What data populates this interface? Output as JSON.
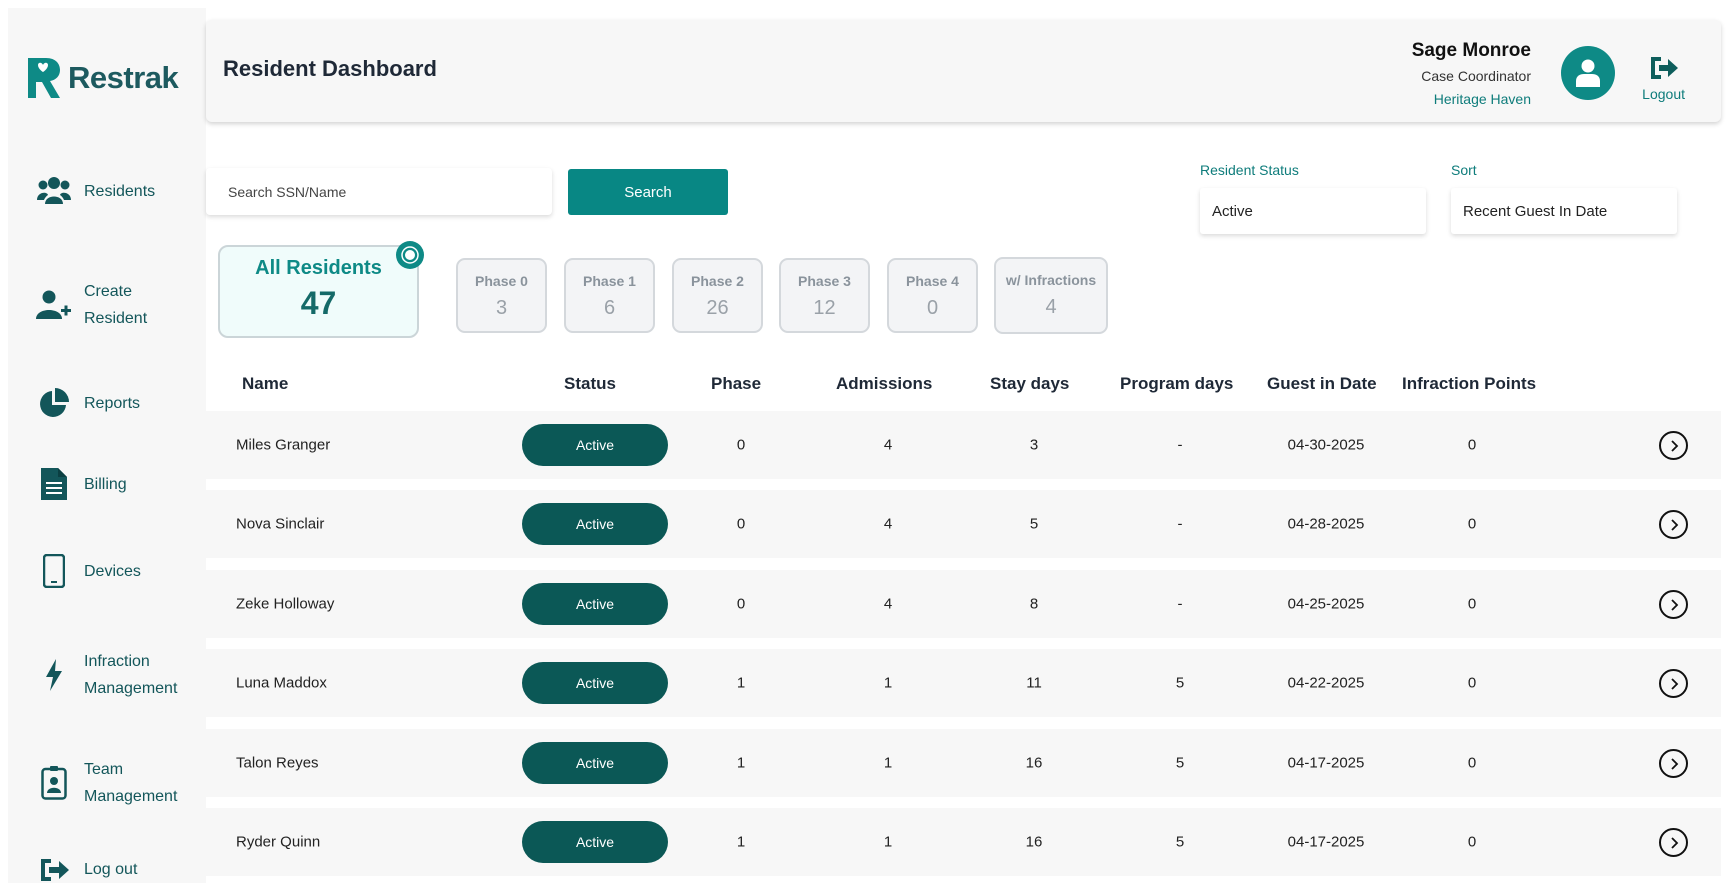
{
  "brand": {
    "name": "Restrak"
  },
  "sidebar": {
    "items": [
      {
        "line1": "Residents",
        "line2": ""
      },
      {
        "line1": "Create",
        "line2": "Resident"
      },
      {
        "line1": "Reports",
        "line2": ""
      },
      {
        "line1": "Billing",
        "line2": ""
      },
      {
        "line1": "Devices",
        "line2": ""
      },
      {
        "line1": "Infraction",
        "line2": "Management"
      },
      {
        "line1": "Team",
        "line2": "Management"
      },
      {
        "line1": "Log out",
        "line2": ""
      }
    ]
  },
  "header": {
    "title": "Resident Dashboard",
    "user_name": "Sage Monroe",
    "user_role": "Case Coordinator",
    "user_org": "Heritage Haven",
    "logout_label": "Logout"
  },
  "search": {
    "placeholder": "Search SSN/Name",
    "button_label": "Search"
  },
  "filters": {
    "status_label": "Resident Status",
    "status_value": "Active",
    "sort_label": "Sort",
    "sort_value": "Recent Guest In Date"
  },
  "summary": {
    "all_label": "All Residents",
    "all_count": "47",
    "cards": [
      {
        "label": "Phase 0",
        "count": "3"
      },
      {
        "label": "Phase 1",
        "count": "6"
      },
      {
        "label": "Phase 2",
        "count": "26"
      },
      {
        "label": "Phase 3",
        "count": "12"
      },
      {
        "label": "Phase 4",
        "count": "0"
      },
      {
        "label": "w/ Infractions",
        "count": "4"
      }
    ]
  },
  "table": {
    "headers": [
      "Name",
      "Status",
      "Phase",
      "Admissions",
      "Stay days",
      "Program days",
      "Guest in Date",
      "Infraction Points"
    ],
    "rows": [
      {
        "name": "Miles Granger",
        "status": "Active",
        "phase": "0",
        "admissions": "4",
        "stay_days": "3",
        "program_days": "-",
        "guest_in_date": "04-30-2025",
        "infraction_points": "0"
      },
      {
        "name": "Nova Sinclair",
        "status": "Active",
        "phase": "0",
        "admissions": "4",
        "stay_days": "5",
        "program_days": "-",
        "guest_in_date": "04-28-2025",
        "infraction_points": "0"
      },
      {
        "name": "Zeke Holloway",
        "status": "Active",
        "phase": "0",
        "admissions": "4",
        "stay_days": "8",
        "program_days": "-",
        "guest_in_date": "04-25-2025",
        "infraction_points": "0"
      },
      {
        "name": "Luna Maddox",
        "status": "Active",
        "phase": "1",
        "admissions": "1",
        "stay_days": "11",
        "program_days": "5",
        "guest_in_date": "04-22-2025",
        "infraction_points": "0"
      },
      {
        "name": "Talon Reyes",
        "status": "Active",
        "phase": "1",
        "admissions": "1",
        "stay_days": "16",
        "program_days": "5",
        "guest_in_date": "04-17-2025",
        "infraction_points": "0"
      },
      {
        "name": "Ryder Quinn",
        "status": "Active",
        "phase": "1",
        "admissions": "1",
        "stay_days": "16",
        "program_days": "5",
        "guest_in_date": "04-17-2025",
        "infraction_points": "0"
      }
    ]
  },
  "colors": {
    "brand": "#1d5a5f",
    "accent": "#088784",
    "status_pill": "#0b5856",
    "nav_text": "#13565a"
  }
}
